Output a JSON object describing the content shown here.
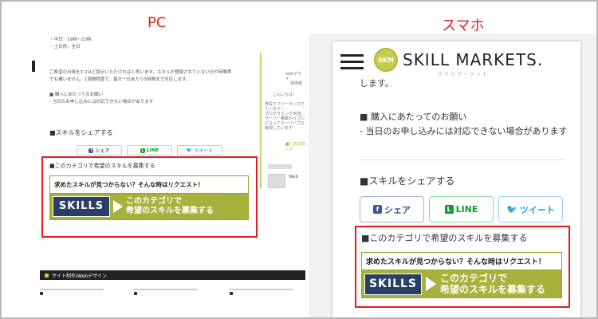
{
  "captions": {
    "pc": "PC",
    "smartphone": "スマホ"
  },
  "pc": {
    "intro_lines": [
      "・平日：19時〜23時",
      "・土日祝：全日"
    ],
    "body_lines": [
      "ご希望の日時を3つほど提示いただければと思います。スキルが登録されていない日や時間帯",
      "でも構いません。1週間程度で、最大一日あたり5時間まで対応します。"
    ],
    "notes": [
      "■ 購入にあたってのお願い",
      "- 当日のお申し込みには対応できない場合があります"
    ],
    "sidebar_lines": [
      "webデザイ",
      "技術者",
      "こんにちは！",
      "普段でフリーランスで",
      "ています！",
      "プログラミング30年",
      "サーバー構築からプロ",
      "になってスーパープロ",
      "実現しています",
      "■このの詳しく"
    ],
    "share_title": "■スキルをシェアする",
    "share_buttons": {
      "facebook": "シェア",
      "line": "LINE",
      "twitter": "ツイート"
    },
    "recruit_title": "■このカテゴリで希望のスキルを募集する",
    "ad_label": "Web",
    "footer_category": "サイト制作/Webデザイン"
  },
  "phone": {
    "logo_badge": "SKM",
    "logo_text": "SKILL MARKETS.",
    "logo_sub": "スキルマーケット",
    "cut_text": "します。",
    "note_title": "■ 購入にあたってのお願い",
    "note_line": "- 当日のお申し込みには対応できない場合があります",
    "share_title": "■スキルをシェアする",
    "share_buttons": {
      "facebook": "シェア",
      "line": "LINE",
      "twitter": "ツイート"
    },
    "recruit_title": "■このカテゴリで希望のスキルを募集する"
  },
  "banner": {
    "headline": "求めたスキルが見つからない？そんな時はリクエスト！",
    "skills_label": "SKILLS",
    "cta_line1": "このカテゴリで",
    "cta_line2": "希望のスキルを募集する"
  },
  "colors": {
    "highlight": "#e51c1c",
    "accent": "#a7b23c",
    "caption": "#e0201f"
  },
  "icons": {
    "facebook": "facebook-icon",
    "line": "line-icon",
    "twitter": "twitter-icon",
    "menu": "hamburger-menu-icon"
  }
}
